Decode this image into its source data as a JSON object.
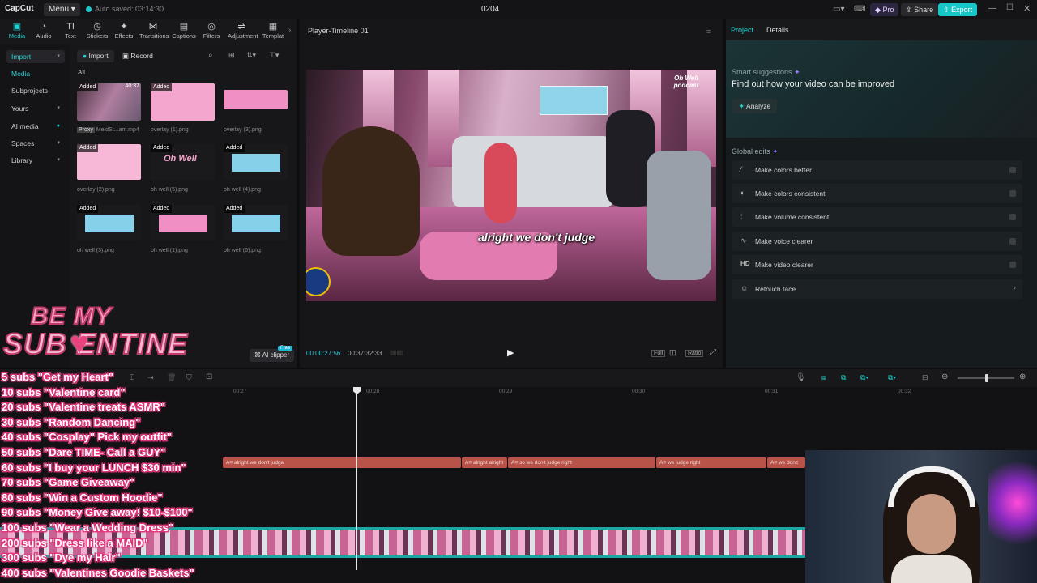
{
  "titlebar": {
    "app": "CapCut",
    "menu": "Menu",
    "autosave": "Auto saved: 03:14:30",
    "project_title": "0204",
    "pro": "Pro",
    "share": "Share",
    "export": "Export"
  },
  "tools": [
    "Media",
    "Audio",
    "Text",
    "Stickers",
    "Effects",
    "Transitions",
    "Captions",
    "Filters",
    "Adjustment",
    "Templat"
  ],
  "tool_icons": [
    "media-icon",
    "audio-icon",
    "text-icon",
    "stickers-icon",
    "effects-icon",
    "transitions-icon",
    "captions-icon",
    "filters-icon",
    "adjustment-icon",
    "templates-icon"
  ],
  "sidenav": {
    "import": "Import",
    "media": "Media",
    "subprojects": "Subprojects",
    "yours": "Yours",
    "ai_media": "AI media",
    "spaces": "Spaces",
    "library": "Library"
  },
  "media": {
    "import": "Import",
    "record": "Record",
    "all": "All",
    "added": "Added",
    "proxy": "Proxy",
    "duration": "40:37",
    "ai_clipper": "AI clipper",
    "free": "Free",
    "items": [
      {
        "name": "MeldSt...am.mp4",
        "color": "#8a5a7a"
      },
      {
        "name": "overlay (1).png",
        "color": "#f4a6cf"
      },
      {
        "name": "overlay (3).png",
        "color": "#f08fc4"
      },
      {
        "name": "overlay (2).png",
        "color": "#f7b8d8"
      },
      {
        "name": "oh well (5).png",
        "color": "#1a1a1d"
      },
      {
        "name": "oh well (4).png",
        "color": "#86d0ea"
      },
      {
        "name": "oh well (3).png",
        "color": "#86d0ea"
      },
      {
        "name": "oh well (1).png",
        "color": "#f08fc4"
      },
      {
        "name": "oh well (6).png",
        "color": "#86d0ea"
      }
    ]
  },
  "player": {
    "title": "Player-Timeline 01",
    "current": "00:00:27:56",
    "total": "00:37:32:33",
    "caption": "alright we don't judge",
    "logo": "Oh Well podcast",
    "full": "Full",
    "ratio": "Ratio"
  },
  "right": {
    "tab_project": "Project",
    "tab_details": "Details",
    "smart_label": "Smart suggestions",
    "smart_title": "Find out how your video can be improved",
    "analyze": "Analyze",
    "global_edits": "Global edits",
    "edits": [
      {
        "label": "Make colors better",
        "icon": "magic-wand-icon"
      },
      {
        "label": "Make colors consistent",
        "icon": "color-consistent-icon"
      },
      {
        "label": "Make volume consistent",
        "icon": "volume-sliders-icon"
      },
      {
        "label": "Make voice clearer",
        "icon": "voice-icon"
      },
      {
        "label": "Make video clearer",
        "icon": "hd-icon"
      },
      {
        "label": "Retouch face",
        "icon": "face-icon"
      }
    ]
  },
  "timeline": {
    "ruler": [
      "00:27",
      "00:28",
      "00:29",
      "00:30",
      "00:31",
      "00:32"
    ],
    "clips": [
      "alright we don't judge",
      "alright alright",
      "so we don't judge right",
      "we judge right",
      "we don't"
    ],
    "playhead_time": "00:00:27:56"
  },
  "overlay": {
    "be_my": "BE MY",
    "subventine": "SUB ENTINE",
    "subs": [
      "5 subs \"Get my Heart\"",
      "10 subs \"Valentine card\"",
      "20 subs \"Valentine treats ASMR\"",
      "30 subs \"Random Dancing\"",
      "40 subs \"Cosplay\" Pick my outfit\"",
      "50 subs \"Dare TIME- Call a GUY\"",
      "60 subs \"I buy your LUNCH $30 min\"",
      "70 subs \"Game Giveaway\"",
      "80 subs \"Win a Custom Hoodie\"",
      "90 subs \"Money Give away! $10-$100\"",
      "100 subs \"Wear a Wedding Dress\"",
      "200 subs \"Dress like a MAID\"",
      "300 subs \"Dye my Hair\"",
      "400 subs \"Valentines Goodie Baskets\""
    ]
  },
  "colors": {
    "accent": "#1fd3d3",
    "subtitle_clip": "#b8534a",
    "overlay_pink": "#e0357a"
  }
}
